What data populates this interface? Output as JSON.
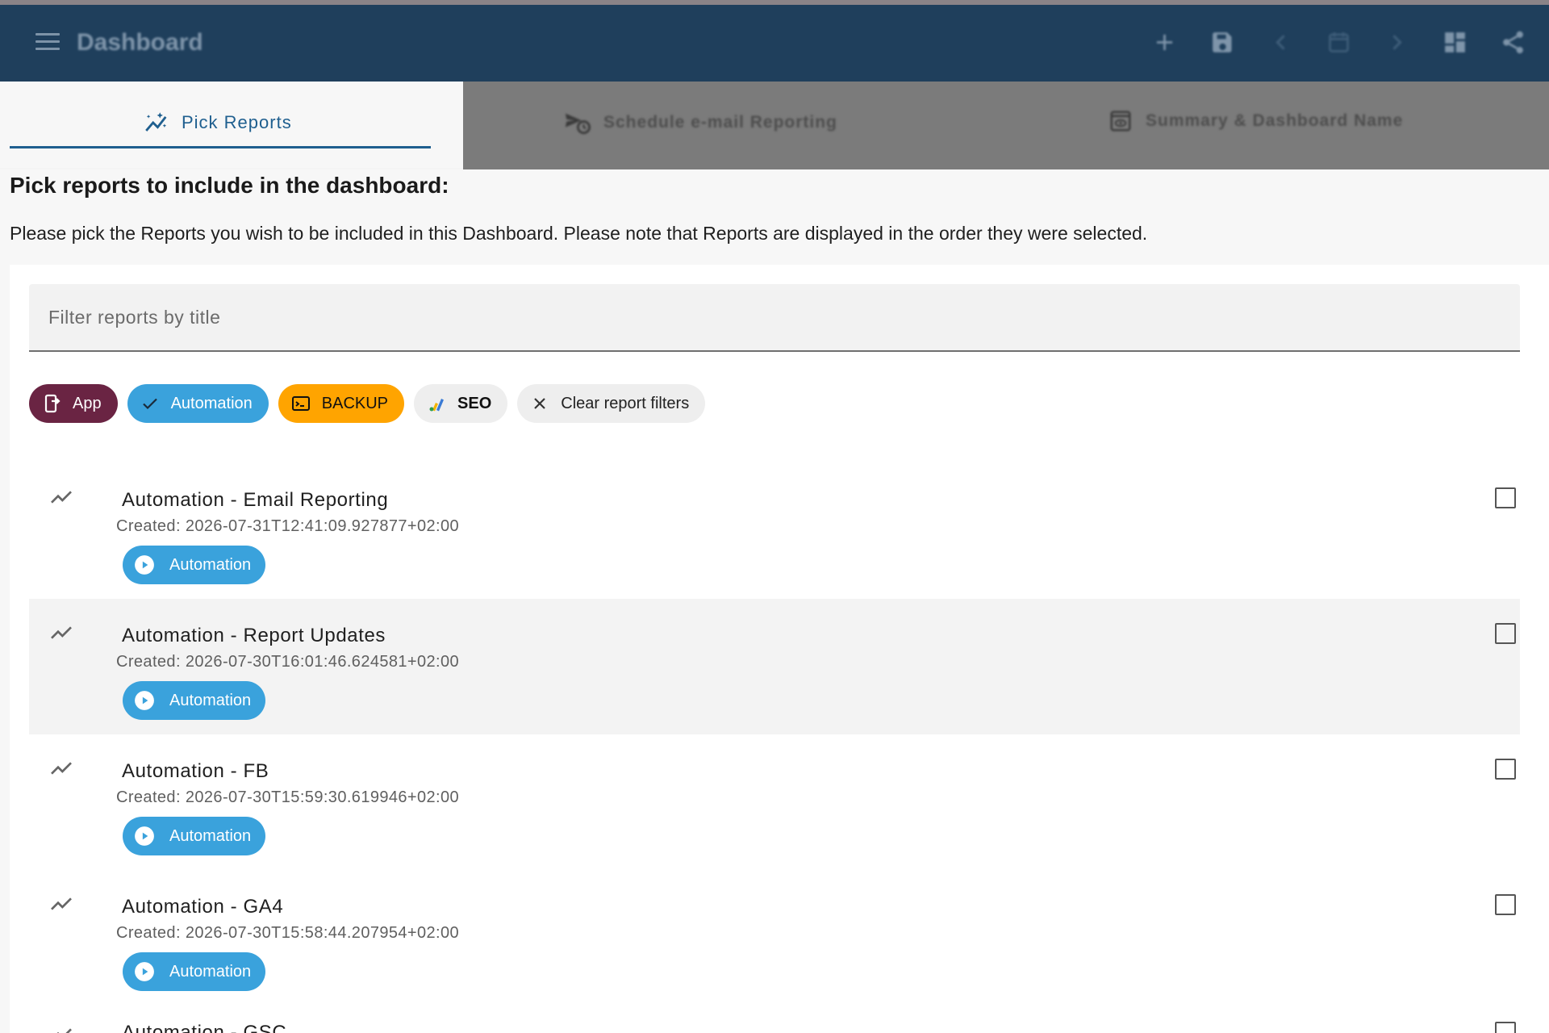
{
  "appbar": {
    "title": "Dashboard",
    "icons": [
      "menu-icon",
      "add-icon",
      "save-icon",
      "chevron-left-icon",
      "calendar-icon",
      "chevron-right-icon",
      "dashboard-icon",
      "share-icon"
    ]
  },
  "tabs": [
    {
      "label": "Pick Reports",
      "icon": "auto-graph-icon",
      "active": true
    },
    {
      "label": "Schedule e-mail Reporting",
      "icon": "schedule-send-icon",
      "active": false
    },
    {
      "label": "Summary & Dashboard Name",
      "icon": "preview-icon",
      "active": false
    }
  ],
  "main": {
    "heading": "Pick reports to include in the dashboard:",
    "description": "Please pick the Reports you wish to be included in this Dashboard. Please note that Reports are displayed in the order they were selected."
  },
  "filter": {
    "placeholder": "Filter reports by title",
    "value": ""
  },
  "chips": [
    {
      "label": "App",
      "icon": "app-icon",
      "bg": "#6a2443",
      "fg": "#ffffff"
    },
    {
      "label": "Automation",
      "icon": "check-icon",
      "bg": "#3aa2dc",
      "fg": "#ffffff"
    },
    {
      "label": "BACKUP",
      "icon": "terminal-icon",
      "bg": "#ffa400",
      "fg": "#111111"
    },
    {
      "label": "SEO",
      "icon": "analytics-icon",
      "bg": "#eeeeee",
      "fg": "#111111"
    },
    {
      "label": "Clear report filters",
      "icon": "close-icon",
      "bg": "#eeeeee",
      "fg": "#222222"
    }
  ],
  "reports": [
    {
      "title": "Automation - Email Reporting",
      "created": "Created: 2026-07-31T12:41:09.927877+02:00",
      "tag": "Automation",
      "checked": false
    },
    {
      "title": "Automation - Report Updates",
      "created": "Created: 2026-07-30T16:01:46.624581+02:00",
      "tag": "Automation",
      "checked": false
    },
    {
      "title": "Automation - FB",
      "created": "Created: 2026-07-30T15:59:30.619946+02:00",
      "tag": "Automation",
      "checked": false
    },
    {
      "title": "Automation - GA4",
      "created": "Created: 2026-07-30T15:58:44.207954+02:00",
      "tag": "Automation",
      "checked": false
    },
    {
      "title": "Automation - GSC",
      "created": "",
      "tag": "",
      "checked": false
    }
  ],
  "colors": {
    "appbar": "#1f3f5c",
    "accent": "#1f5f8f",
    "automation": "#3aa2dc",
    "app": "#6a2443",
    "backup": "#ffa400"
  }
}
